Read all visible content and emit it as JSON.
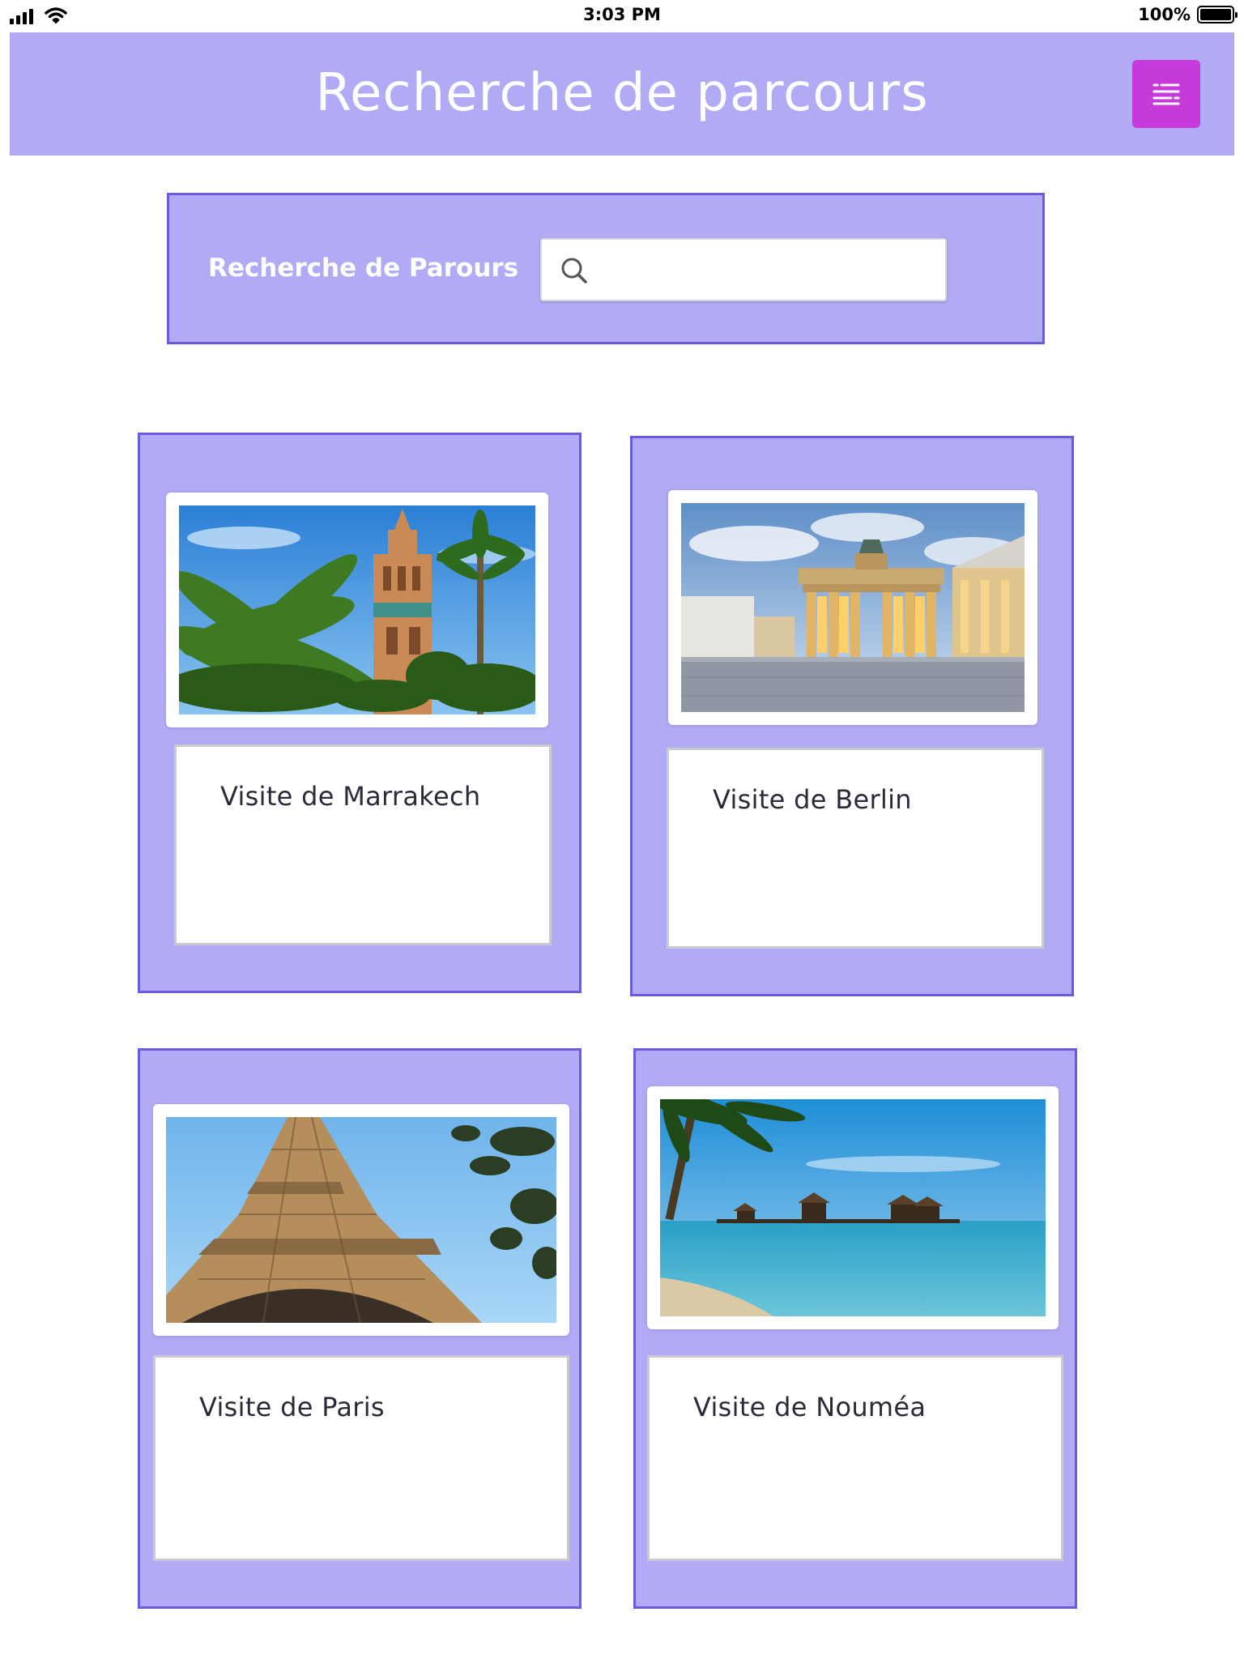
{
  "status_bar": {
    "time": "3:03 PM",
    "battery": "100%"
  },
  "header": {
    "title": "Recherche de parcours",
    "menu_icon": "filter-list-icon"
  },
  "search": {
    "label": "Recherche de Parours",
    "placeholder": "",
    "value": ""
  },
  "colors": {
    "panel": "#b1aaf5",
    "panel_border": "#6a5ae0",
    "menu_button": "#c53ad9"
  },
  "cards": [
    {
      "title": "Visite de Marrakech",
      "image": "koutoubia-mosque-palm-trees-image"
    },
    {
      "title": "Visite de Berlin",
      "image": "brandenburg-gate-image"
    },
    {
      "title": "Visite de Paris",
      "image": "eiffel-tower-image"
    },
    {
      "title": "Visite de Nouméa",
      "image": "tropical-beach-pier-image"
    }
  ]
}
